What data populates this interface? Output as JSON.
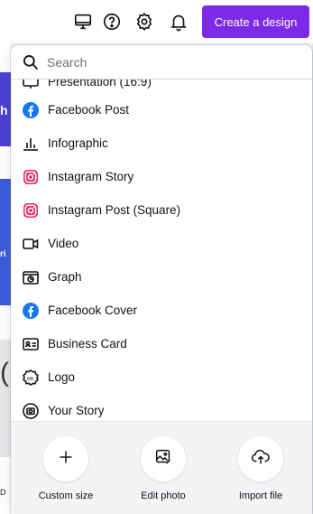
{
  "topbar": {
    "icons": [
      "desktop-icon",
      "help-icon",
      "settings-icon",
      "bell-icon"
    ],
    "create_label": "Create a design",
    "accent": "#7d2ae8"
  },
  "background": {
    "peek_chars": [
      "h",
      "ri",
      "(",
      "D"
    ]
  },
  "dropdown": {
    "search": {
      "placeholder": "Search",
      "value": ""
    },
    "items": [
      {
        "label": "Presentation (16:9)",
        "icon": "presentation-icon"
      },
      {
        "label": "Facebook Post",
        "icon": "facebook-icon"
      },
      {
        "label": "Infographic",
        "icon": "infographic-icon"
      },
      {
        "label": "Instagram Story",
        "icon": "instagram-icon"
      },
      {
        "label": "Instagram Post (Square)",
        "icon": "instagram-icon"
      },
      {
        "label": "Video",
        "icon": "video-icon"
      },
      {
        "label": "Graph",
        "icon": "graph-icon"
      },
      {
        "label": "Facebook Cover",
        "icon": "facebook-icon"
      },
      {
        "label": "Business Card",
        "icon": "business-card-icon"
      },
      {
        "label": "Logo",
        "icon": "logo-icon"
      },
      {
        "label": "Your Story",
        "icon": "story-icon"
      }
    ],
    "actions": [
      {
        "label": "Custom size",
        "icon": "plus-icon"
      },
      {
        "label": "Edit photo",
        "icon": "edit-photo-icon"
      },
      {
        "label": "Import file",
        "icon": "cloud-upload-icon"
      }
    ],
    "colors": {
      "facebook": "#1877f2",
      "instagram": "#e1306c"
    }
  }
}
